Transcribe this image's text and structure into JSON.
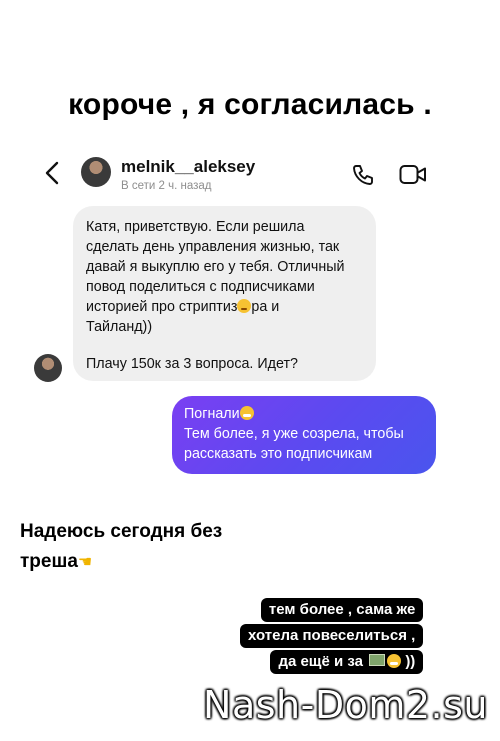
{
  "story": {
    "headline": "короче , я согласилась .",
    "caption_left": [
      "Надеюсь сегодня без",
      "треша"
    ],
    "caption_right": [
      "тем более , сама же",
      "хотела повеселиться ,",
      "да ещё и за",
      "))"
    ]
  },
  "chat_header": {
    "username": "melnik__aleksey",
    "last_seen": "В сети 2 ч. назад",
    "icons": [
      "back-icon",
      "phone-icon",
      "video-camera-icon"
    ]
  },
  "messages": {
    "incoming": {
      "text_1_lines": [
        "Катя, приветствую. Если решила",
        "сделать день управления жизнью, так",
        "давай я выкуплю его у тебя. Отличный",
        "повод поделиться с подписчиками",
        "историей про стриптиз",
        "ра и",
        "Тайланд))"
      ],
      "text_2": "Плачу 150к за 3 вопроса. Идет?"
    },
    "outgoing": {
      "lines": [
        "Погнали",
        "Тем более, я уже созрела, чтобы",
        "рассказать это подписчикам"
      ]
    }
  },
  "watermark": "Nash-Dom2.su",
  "colors": {
    "incoming_bubble": "#efefef",
    "outgoing_bubble": "#6a47f0",
    "caption_bg": "#000000"
  }
}
